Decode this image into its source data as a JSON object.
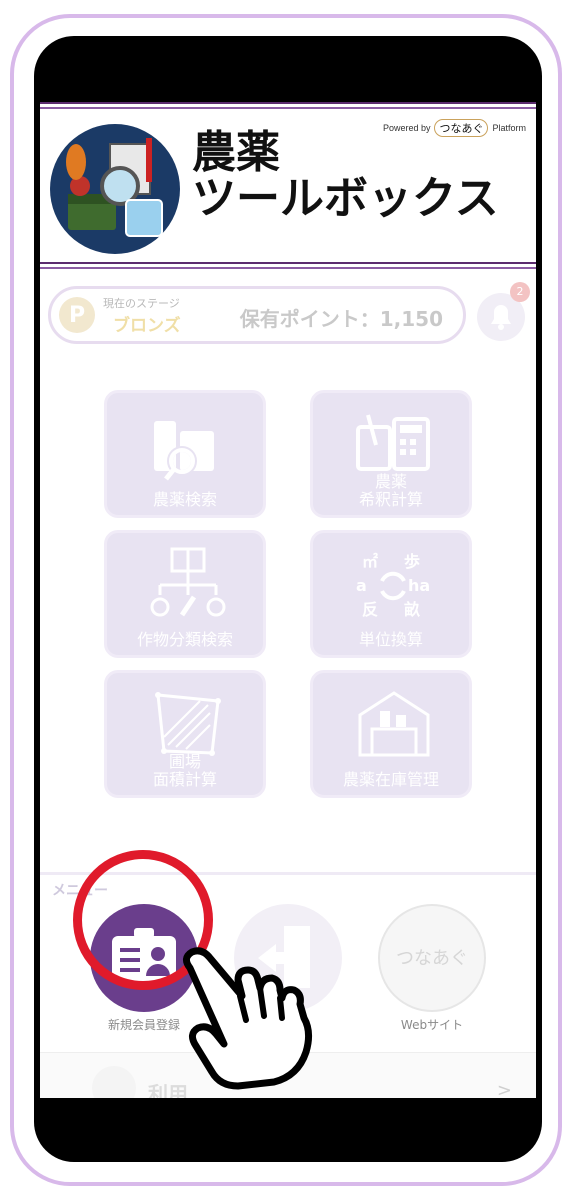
{
  "header": {
    "powered_prefix": "Powered by",
    "powered_brand": "つなあぐ",
    "powered_suffix": "Platform",
    "title_line1": "農薬",
    "title_line2": "ツールボックス"
  },
  "status": {
    "stage_label": "現在のステージ",
    "stage_value": "ブロンズ",
    "points_text": "保有ポイント：1,150",
    "notification_count": "2"
  },
  "tools": [
    {
      "label": "農薬検索"
    },
    {
      "label": "農薬\n希釈計算"
    },
    {
      "label": "作物分類検索"
    },
    {
      "label": "単位換算"
    },
    {
      "label": "圃場\n面積計算"
    },
    {
      "label": "農薬在庫管理"
    }
  ],
  "unit_icon": {
    "m2": "㎡",
    "step": "歩",
    "a": "a",
    "ha": "ha",
    "tan": "反",
    "se": "畝"
  },
  "menu": {
    "heading": "メニュー",
    "items": [
      {
        "label": "新規会員登録"
      },
      {
        "label": ""
      },
      {
        "label": "Webサイト",
        "logo_text": "つなあぐ"
      }
    ]
  },
  "bottom": {
    "usage_label": "利用",
    "chevron": ">"
  },
  "colors": {
    "accent": "#5b2c6f",
    "highlight_ring": "#e01a2b",
    "tile_bg": "#e8e3f2"
  }
}
